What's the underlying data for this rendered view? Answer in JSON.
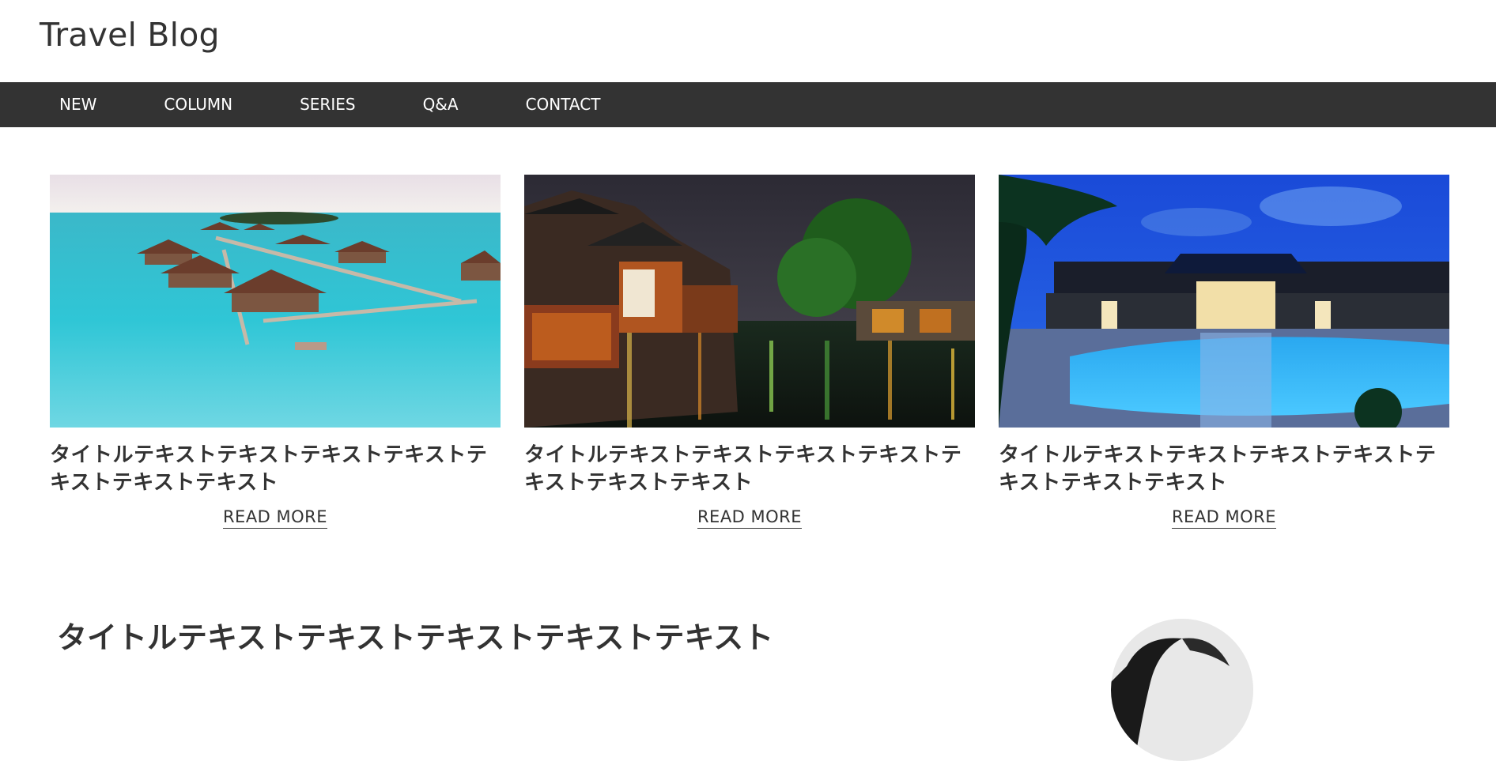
{
  "site": {
    "title": "Travel Blog"
  },
  "nav": {
    "items": [
      {
        "label": "NEW"
      },
      {
        "label": "COLUMN"
      },
      {
        "label": "SERIES"
      },
      {
        "label": "Q&A"
      },
      {
        "label": "CONTACT"
      }
    ]
  },
  "cards": [
    {
      "title": "タイトルテキストテキストテキストテキストテキストテキストテキスト",
      "read_more": "READ MORE",
      "image": "overwater-bungalows-photo"
    },
    {
      "title": "タイトルテキストテキストテキストテキストテキストテキストテキスト",
      "read_more": "READ MORE",
      "image": "water-town-night-photo"
    },
    {
      "title": "タイトルテキストテキストテキストテキストテキストテキストテキスト",
      "read_more": "READ MORE",
      "image": "resort-pool-night-photo"
    }
  ],
  "feature": {
    "title": "タイトルテキストテキストテキストテキストテキスト",
    "image": "profile-photo"
  },
  "colors": {
    "nav_bg": "#333333",
    "text": "#333333",
    "background": "#ffffff"
  }
}
